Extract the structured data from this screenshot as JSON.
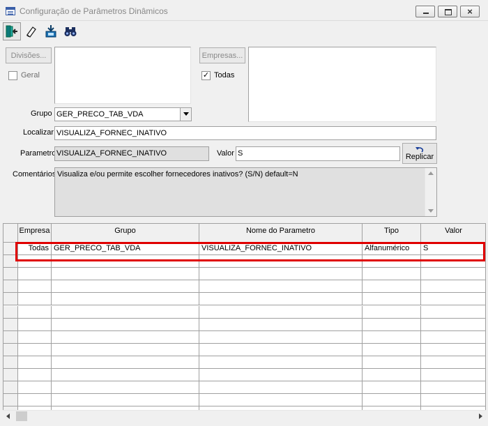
{
  "window": {
    "title": "Configuração de Parâmetros Dinâmicos"
  },
  "toolbar": {
    "icons": [
      "exit-icon",
      "eraser-icon",
      "save-icon",
      "binoculars-icon"
    ]
  },
  "divisoes": {
    "button_label": "Divisões...",
    "geral_label": "Geral",
    "geral_checked": false
  },
  "empresas": {
    "button_label": "Empresas...",
    "todas_label": "Todas",
    "todas_checked": true,
    "check_mark": "✓"
  },
  "grupo": {
    "label": "Grupo",
    "value": "GER_PRECO_TAB_VDA"
  },
  "localizar": {
    "label": "Localizar",
    "value": "VISUALIZA_FORNEC_INATIVO"
  },
  "parametro": {
    "label": "Parametro",
    "value": "VISUALIZA_FORNEC_INATIVO"
  },
  "valor": {
    "label": "Valor",
    "value": "S"
  },
  "replicar": {
    "label": "Replicar"
  },
  "comentarios": {
    "label": "Comentários",
    "value": "Visualiza e/ou permite escolher fornecedores inativos? (S/N) default=N"
  },
  "grid": {
    "columns": [
      "Empresa",
      "Grupo",
      "Nome do Parametro",
      "Tipo",
      "Valor"
    ],
    "rows": [
      [
        "Todas",
        "GER_PRECO_TAB_VDA",
        "VISUALIZA_FORNEC_INATIVO",
        "Alfanumérico",
        "S"
      ]
    ],
    "highlight_color": "#e00000"
  }
}
